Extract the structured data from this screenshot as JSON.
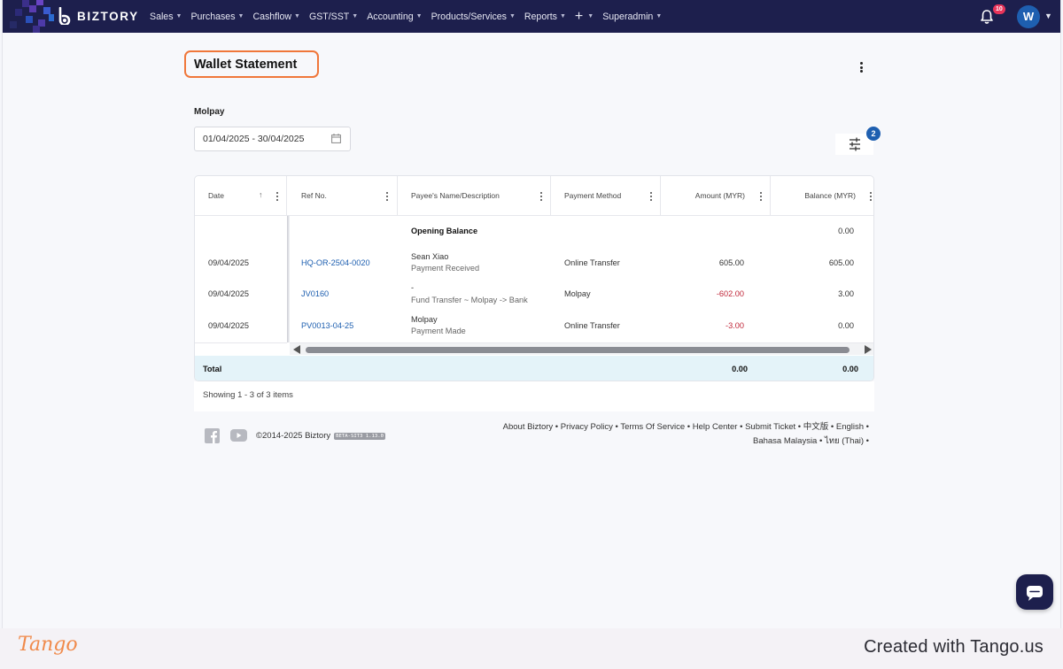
{
  "app": {
    "name": "BIZTORY"
  },
  "nav": {
    "items": [
      {
        "label": "Sales"
      },
      {
        "label": "Purchases"
      },
      {
        "label": "Cashflow"
      },
      {
        "label": "GST/SST"
      },
      {
        "label": "Accounting"
      },
      {
        "label": "Products/Services"
      },
      {
        "label": "Reports"
      }
    ],
    "plus": "+",
    "superadmin": "Superadmin",
    "notification_count": "10",
    "avatar_initial": "W"
  },
  "page": {
    "title": "Wallet Statement",
    "wallet_name": "Molpay",
    "date_range": "01/04/2025 - 30/04/2025",
    "filter_count": "2"
  },
  "table": {
    "headers": {
      "date": "Date",
      "ref": "Ref No.",
      "payee": "Payee's Name/Description",
      "method": "Payment Method",
      "amount": "Amount (MYR)",
      "balance": "Balance (MYR)"
    },
    "opening": {
      "label": "Opening Balance",
      "balance": "0.00"
    },
    "rows": [
      {
        "date": "09/04/2025",
        "ref": "HQ-OR-2504-0020",
        "payee": "Sean Xiao",
        "desc": "Payment Received",
        "method": "Online Transfer",
        "amount": "605.00",
        "balance": "605.00"
      },
      {
        "date": "09/04/2025",
        "ref": "JV0160",
        "payee": "-",
        "desc": "Fund Transfer ~ Molpay -> Bank",
        "method": "Molpay",
        "amount": "-602.00",
        "balance": "3.00"
      },
      {
        "date": "09/04/2025",
        "ref": "PV0013-04-25",
        "payee": "Molpay",
        "desc": "Payment Made",
        "method": "Online Transfer",
        "amount": "-3.00",
        "balance": "0.00"
      }
    ],
    "total": {
      "label": "Total",
      "amount": "0.00",
      "balance": "0.00"
    },
    "showing": "Showing 1 - 3 of 3 items"
  },
  "footer": {
    "copyright": "©2014-2025 Biztory",
    "version": "BETA-SIT3 1.13.0",
    "links": [
      "About Biztory",
      "Privacy Policy",
      "Terms Of Service",
      "Help Center",
      "Submit Ticket",
      "中文版",
      "English",
      "Bahasa Malaysia",
      "ไทย (Thai)"
    ]
  },
  "tango": {
    "logo": "Tango",
    "created": "Created with Tango.us"
  },
  "colors": {
    "navbar": "#1d1f4d",
    "accent": "#1e5fb0",
    "highlight": "#f0773a",
    "negative": "#c0283a"
  }
}
